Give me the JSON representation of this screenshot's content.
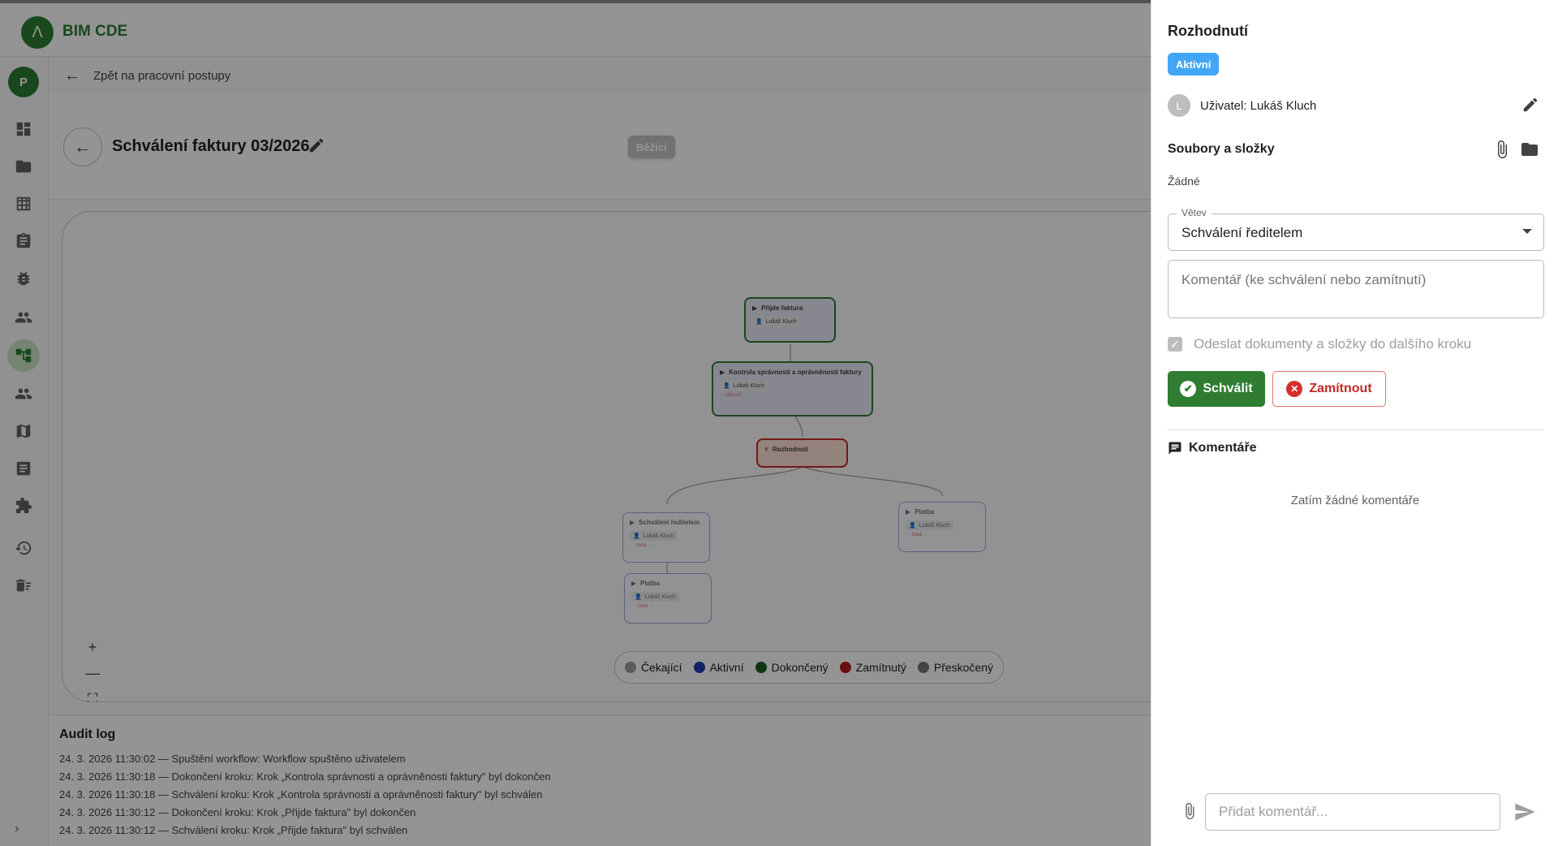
{
  "app": {
    "logo_glyph": "Λ",
    "title": "BIM CDE"
  },
  "rail": {
    "avatar_letter": "P",
    "expand_glyph": "›"
  },
  "backbar": {
    "label": "Zpět na pracovní postupy"
  },
  "workflow": {
    "title": "Schválení faktury 03/2026",
    "status": "Běžící",
    "nodes": [
      {
        "title": "Přijde faktura",
        "user": "Lukáš Kluch",
        "status": ""
      },
      {
        "title": "Kontrola správnosti a oprávněnosti faktury",
        "user": "Lukáš Kluch",
        "status": "··· dokonč"
      },
      {
        "title": "Rozhodnutí",
        "user": "",
        "status": ""
      },
      {
        "title": "Schválení ředitelem",
        "user": "Lukáš Kluch",
        "status": "··· čeká ···"
      },
      {
        "title": "Platba",
        "user": "Lukáš Kluch",
        "status": "··· čeká ···"
      },
      {
        "title": "Platba",
        "user": "Lukáš Kluch",
        "status": "··· čeká ···"
      }
    ],
    "zoom": {
      "in": "+",
      "out": "—",
      "fit": "⛶",
      "lock": "🔒"
    },
    "legend": [
      {
        "label": "Čekající",
        "color": "#9e9e9e"
      },
      {
        "label": "Aktivní",
        "color": "#1e40af"
      },
      {
        "label": "Dokončený",
        "color": "#1b5e20"
      },
      {
        "label": "Zamítnutý",
        "color": "#b71c1c"
      },
      {
        "label": "Přeskočený",
        "color": "#757575"
      }
    ]
  },
  "audit": {
    "title": "Audit log",
    "entries": [
      "24. 3. 2026 11:30:02 — Spuštění workflow: Workflow spuštěno uživatelem",
      "24. 3. 2026 11:30:18 — Dokončení kroku: Krok „Kontrola správnosti a oprávněnosti faktury\" byl dokončen",
      "24. 3. 2026 11:30:18 — Schválení kroku: Krok „Kontrola správnosti a oprávněnosti faktury\" byl schválen",
      "24. 3. 2026 11:30:12 — Dokončení kroku: Krok „Přijde faktura\" byl dokončen",
      "24. 3. 2026 11:30:12 — Schválení kroku: Krok „Přijde faktura\" byl schválen"
    ]
  },
  "panel": {
    "title": "Rozhodnutí",
    "badge": "Aktivní",
    "user_initial": "L",
    "user_label": "Uživatel: Lukáš Kluch",
    "files_title": "Soubory a složky",
    "files_value": "Žádné",
    "branch_label": "Větev",
    "branch_value": "Schválení ředitelem",
    "comment_placeholder": "Komentář (ke schválení nebo zamítnutí)",
    "checkbox_label": "Odeslat dokumenty a složky do dalšího kroku",
    "approve_label": "Schválit",
    "reject_label": "Zamítnout",
    "comments_title": "Komentáře",
    "comments_empty": "Zatím žádné komentáře",
    "add_comment_placeholder": "Přidat komentář..."
  }
}
